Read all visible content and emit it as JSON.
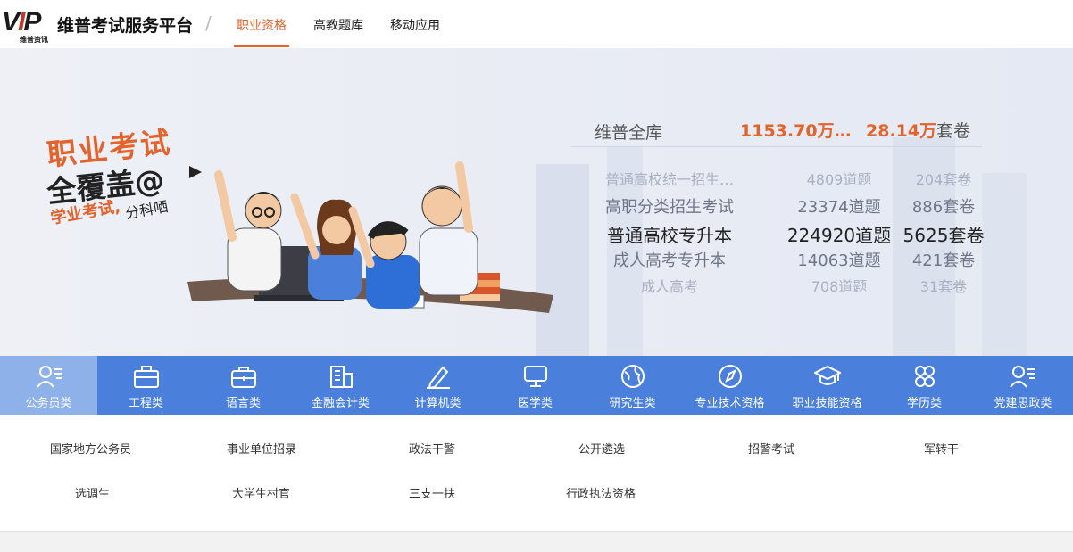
{
  "header": {
    "logo_text": "VIP",
    "logo_sub": "维普资讯",
    "site_title": "维普考试服务平台",
    "separator": "/",
    "tabs": [
      {
        "label": "职业资格",
        "active": true
      },
      {
        "label": "高教题库",
        "active": false
      },
      {
        "label": "移动应用",
        "active": false
      }
    ]
  },
  "banner": {
    "slogan_line1": "职业考试",
    "slogan_line2": "全覆盖@",
    "slogan_line3": "学业考试,",
    "slogan_line4": "分科哂",
    "stats": {
      "total_label": "维普全库",
      "total_questions": "1153.70万…",
      "total_sets_num": "28.14万",
      "total_sets_unit": "套卷",
      "rows": [
        {
          "name": "普通高校统一招生…",
          "questions": "4809道题",
          "sets": "204套卷"
        },
        {
          "name": "高职分类招生考试",
          "questions": "23374道题",
          "sets": "886套卷"
        },
        {
          "name": "普通高校专升本",
          "questions": "224920道题",
          "sets": "5625套卷"
        },
        {
          "name": "成人高考专升本",
          "questions": "14063道题",
          "sets": "421套卷"
        },
        {
          "name": "成人高考",
          "questions": "708道题",
          "sets": "31套卷"
        }
      ]
    }
  },
  "categories": [
    {
      "label": "公务员类",
      "icon": "civil-servant-icon",
      "active": true
    },
    {
      "label": "工程类",
      "icon": "toolbox-icon",
      "active": false
    },
    {
      "label": "语言类",
      "icon": "briefcase-icon",
      "active": false
    },
    {
      "label": "金融会计类",
      "icon": "building-icon",
      "active": false
    },
    {
      "label": "计算机类",
      "icon": "pen-icon",
      "active": false
    },
    {
      "label": "医学类",
      "icon": "monitor-icon",
      "active": false
    },
    {
      "label": "研究生类",
      "icon": "globe-icon",
      "active": false
    },
    {
      "label": "专业技术资格",
      "icon": "compass-icon",
      "active": false
    },
    {
      "label": "职业技能资格",
      "icon": "graduation-cap-icon",
      "active": false
    },
    {
      "label": "学历类",
      "icon": "grid-icon",
      "active": false
    },
    {
      "label": "党建思政类",
      "icon": "person-list-icon",
      "active": false
    }
  ],
  "subcategories": [
    "国家地方公务员",
    "事业单位招录",
    "政法干警",
    "公开遴选",
    "招警考试",
    "军转干",
    "选调生",
    "大学生村官",
    "三支一扶",
    "行政执法资格"
  ],
  "colors": {
    "accent": "#e4632a",
    "category_bar": "#4a7fdb",
    "category_active": "#8fb1ea"
  }
}
